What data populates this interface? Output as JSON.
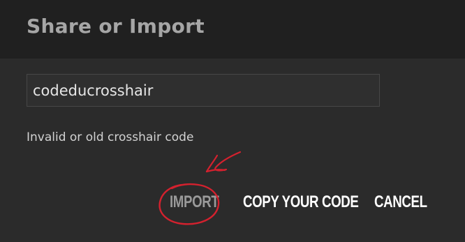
{
  "dialog": {
    "title": "Share or Import",
    "code_input_value": "codeducrosshair",
    "error_message": "Invalid or old crosshair code",
    "buttons": {
      "import": "IMPORT",
      "copy": "COPY YOUR CODE",
      "cancel": "CANCEL"
    }
  },
  "colors": {
    "background": "#2b2b2b",
    "header": "#202020",
    "disabled_button": "#9a9a9a",
    "annotation": "#d4212e"
  },
  "annotation": {
    "type": "red-circle-and-arrow",
    "target": "import-button"
  }
}
